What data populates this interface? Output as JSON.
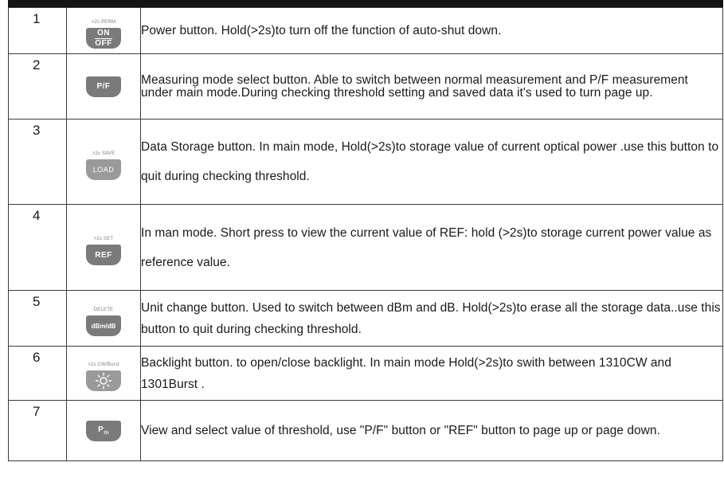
{
  "rows": [
    {
      "number": "1",
      "hold_label": ">2s PERM",
      "key_top": "ON",
      "key_bottom": "OFF",
      "description": "Power button. Hold(>2s)to turn off the function of auto-shut down."
    },
    {
      "number": "2",
      "hold_label": "",
      "key_label": "P/F",
      "description": "Measuring mode select button. Able to switch  between normal measurement and P/F measurement under main mode.During checking threshold setting and saved data it's used to turn page up."
    },
    {
      "number": "3",
      "hold_label": ">2s SAVE",
      "key_label": "LOAD",
      "description": "Data Storage button. In main mode, Hold(>2s)to storage value of current optical power .use this button to quit during checking threshold."
    },
    {
      "number": "4",
      "hold_label": ">2s SET",
      "key_label": "REF",
      "description": "In man mode. Short press to view the current value of REF: hold (>2s)to storage current power value as reference value."
    },
    {
      "number": "5",
      "hold_label": "DELETE",
      "key_label": "dBm/dB",
      "description": "Unit change button. Used to switch between dBm and dB. Hold(>2s)to erase all the storage data..use this button to quit during checking threshold."
    },
    {
      "number": "6",
      "hold_label": ">2s CW/Burst",
      "key_icon": "sun-icon",
      "description": "Backlight button. to open/close backlight. In main mode Hold(>2s)to swith between 1310CW and 1301Burst ."
    },
    {
      "number": "7",
      "hold_label": "",
      "key_label": "P",
      "key_subscript": "th",
      "description": "View and select value of threshold, use \"P/F\" button or \"REF\" button to page up or page down."
    }
  ],
  "colors": {
    "key_fill": "#7a7a7a",
    "rule": "#141414",
    "border": "#3a3a3a"
  }
}
